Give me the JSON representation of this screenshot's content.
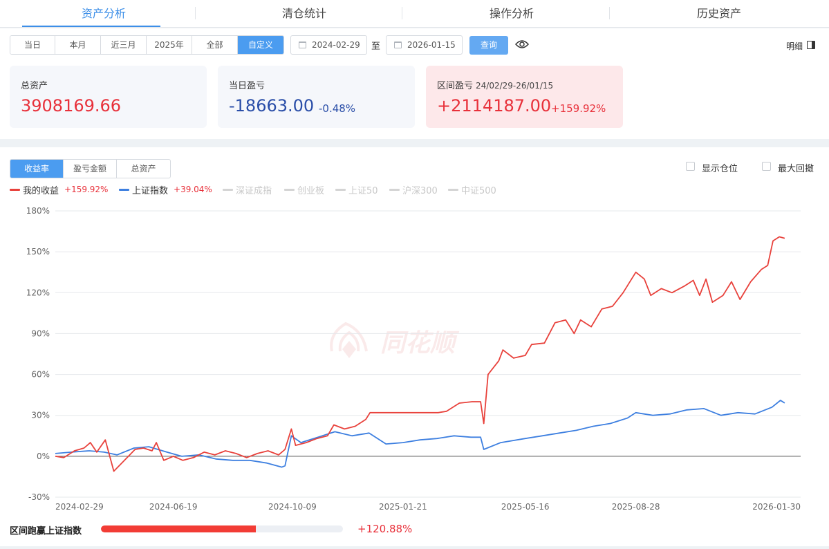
{
  "top_tabs": [
    {
      "label": "资产分析",
      "active": true
    },
    {
      "label": "清仓统计",
      "active": false
    },
    {
      "label": "操作分析",
      "active": false
    },
    {
      "label": "历史资产",
      "active": false
    }
  ],
  "toolbar": {
    "ranges": [
      {
        "label": "当日",
        "active": false
      },
      {
        "label": "本月",
        "active": false
      },
      {
        "label": "近三月",
        "active": false
      },
      {
        "label": "2025年",
        "active": false
      },
      {
        "label": "全部",
        "active": false
      },
      {
        "label": "自定义",
        "active": true
      }
    ],
    "start_date": "2024-02-29",
    "to_label": "至",
    "end_date": "2026-01-15",
    "query_label": "查询",
    "detail_label": "明细"
  },
  "cards": {
    "total_assets": {
      "label": "总资产",
      "value": "3908169.66"
    },
    "daily_pnl": {
      "label": "当日盈亏",
      "value": "-18663.00",
      "pct": "-0.48%"
    },
    "range_pnl": {
      "label": "区间盈亏",
      "range": "24/02/29-26/01/15",
      "value": "+2114187.00",
      "pct": "+159.92%"
    }
  },
  "chart_tabs": [
    {
      "label": "收益率",
      "active": true
    },
    {
      "label": "盈亏金额",
      "active": false
    },
    {
      "label": "总资产",
      "active": false
    }
  ],
  "options": {
    "show_position": "显示仓位",
    "max_drawdown": "最大回撤"
  },
  "legend": [
    {
      "name": "我的收益",
      "value": "+159.92%",
      "color": "#e8413b",
      "active": true
    },
    {
      "name": "上证指数",
      "value": "+39.04%",
      "color": "#3d7fe0",
      "active": true
    },
    {
      "name": "深证成指",
      "active": false
    },
    {
      "name": "创业板",
      "active": false
    },
    {
      "name": "上证50",
      "active": false
    },
    {
      "name": "沪深300",
      "active": false
    },
    {
      "name": "中证500",
      "active": false
    }
  ],
  "watermark": "同花顺",
  "chart_data": {
    "type": "line",
    "y_unit": "%",
    "ylim": [
      -30,
      180
    ],
    "yticks": [
      -30,
      0,
      30,
      60,
      90,
      120,
      150,
      180
    ],
    "ytick_labels": [
      "-30%",
      "0%",
      "30%",
      "60%",
      "90%",
      "120%",
      "150%",
      "180%"
    ],
    "xtick_labels": [
      "2024-02-29",
      "2024-06-19",
      "2024-10-09",
      "2025-01-21",
      "2025-05-16",
      "2025-08-28",
      "2026-01-30"
    ],
    "grid": true,
    "series": [
      {
        "name": "我的收益",
        "color": "#e8413b",
        "points": [
          [
            "2024-02-29",
            0
          ],
          [
            "2024-03-08",
            -1
          ],
          [
            "2024-03-18",
            4
          ],
          [
            "2024-03-27",
            6
          ],
          [
            "2024-04-02",
            10
          ],
          [
            "2024-04-08",
            3
          ],
          [
            "2024-04-16",
            12
          ],
          [
            "2024-04-24",
            -11
          ],
          [
            "2024-05-04",
            -3
          ],
          [
            "2024-05-14",
            5
          ],
          [
            "2024-05-22",
            6
          ],
          [
            "2024-05-30",
            4
          ],
          [
            "2024-06-03",
            10
          ],
          [
            "2024-06-10",
            -3
          ],
          [
            "2024-06-19",
            0
          ],
          [
            "2024-06-28",
            -3
          ],
          [
            "2024-07-08",
            -1
          ],
          [
            "2024-07-18",
            3
          ],
          [
            "2024-07-28",
            1
          ],
          [
            "2024-08-07",
            4
          ],
          [
            "2024-08-17",
            2
          ],
          [
            "2024-08-27",
            -1
          ],
          [
            "2024-09-06",
            2
          ],
          [
            "2024-09-16",
            4
          ],
          [
            "2024-09-26",
            1
          ],
          [
            "2024-10-02",
            5
          ],
          [
            "2024-10-08",
            20
          ],
          [
            "2024-10-12",
            8
          ],
          [
            "2024-10-22",
            10
          ],
          [
            "2024-11-01",
            13
          ],
          [
            "2024-11-11",
            15
          ],
          [
            "2024-11-17",
            23
          ],
          [
            "2024-11-27",
            20
          ],
          [
            "2024-12-07",
            22
          ],
          [
            "2024-12-17",
            27
          ],
          [
            "2024-12-21",
            32
          ],
          [
            "2025-01-21",
            32
          ],
          [
            "2025-02-23",
            32
          ],
          [
            "2025-03-03",
            33
          ],
          [
            "2025-03-15",
            39
          ],
          [
            "2025-03-27",
            40
          ],
          [
            "2025-04-04",
            40
          ],
          [
            "2025-04-07",
            24
          ],
          [
            "2025-04-11",
            60
          ],
          [
            "2025-04-21",
            70
          ],
          [
            "2025-04-25",
            78
          ],
          [
            "2025-05-05",
            72
          ],
          [
            "2025-05-16",
            74
          ],
          [
            "2025-05-22",
            82
          ],
          [
            "2025-06-03",
            83
          ],
          [
            "2025-06-13",
            98
          ],
          [
            "2025-06-23",
            100
          ],
          [
            "2025-07-01",
            90
          ],
          [
            "2025-07-07",
            100
          ],
          [
            "2025-07-17",
            95
          ],
          [
            "2025-07-27",
            108
          ],
          [
            "2025-08-06",
            110
          ],
          [
            "2025-08-16",
            120
          ],
          [
            "2025-08-28",
            135
          ],
          [
            "2025-09-05",
            130
          ],
          [
            "2025-09-11",
            118
          ],
          [
            "2025-09-21",
            123
          ],
          [
            "2025-10-01",
            120
          ],
          [
            "2025-10-13",
            125
          ],
          [
            "2025-10-21",
            129
          ],
          [
            "2025-10-27",
            118
          ],
          [
            "2025-11-02",
            130
          ],
          [
            "2025-11-08",
            113
          ],
          [
            "2025-11-18",
            118
          ],
          [
            "2025-11-26",
            128
          ],
          [
            "2025-12-04",
            115
          ],
          [
            "2025-12-14",
            128
          ],
          [
            "2025-12-24",
            137
          ],
          [
            "2025-12-30",
            140
          ],
          [
            "2026-01-04",
            158
          ],
          [
            "2026-01-10",
            161
          ],
          [
            "2026-01-15",
            159.92
          ]
        ]
      },
      {
        "name": "上证指数",
        "color": "#3d7fe0",
        "points": [
          [
            "2024-02-29",
            2
          ],
          [
            "2024-03-15",
            3
          ],
          [
            "2024-04-01",
            4
          ],
          [
            "2024-04-15",
            3
          ],
          [
            "2024-04-27",
            1
          ],
          [
            "2024-05-13",
            6
          ],
          [
            "2024-05-27",
            7
          ],
          [
            "2024-06-13",
            3
          ],
          [
            "2024-06-27",
            0
          ],
          [
            "2024-07-13",
            1
          ],
          [
            "2024-07-29",
            -2
          ],
          [
            "2024-08-14",
            -3
          ],
          [
            "2024-08-30",
            -3
          ],
          [
            "2024-09-15",
            -5
          ],
          [
            "2024-09-29",
            -8
          ],
          [
            "2024-10-02",
            -7
          ],
          [
            "2024-10-08",
            15
          ],
          [
            "2024-10-17",
            10
          ],
          [
            "2024-11-02",
            14
          ],
          [
            "2024-11-18",
            18
          ],
          [
            "2024-12-04",
            15
          ],
          [
            "2024-12-20",
            17
          ],
          [
            "2025-01-05",
            9
          ],
          [
            "2025-01-21",
            10
          ],
          [
            "2025-02-06",
            12
          ],
          [
            "2025-02-22",
            13
          ],
          [
            "2025-03-10",
            15
          ],
          [
            "2025-03-26",
            14
          ],
          [
            "2025-04-04",
            14
          ],
          [
            "2025-04-07",
            5
          ],
          [
            "2025-04-23",
            10
          ],
          [
            "2025-05-16",
            13
          ],
          [
            "2025-06-01",
            15
          ],
          [
            "2025-06-17",
            17
          ],
          [
            "2025-07-03",
            19
          ],
          [
            "2025-07-19",
            22
          ],
          [
            "2025-08-04",
            24
          ],
          [
            "2025-08-20",
            28
          ],
          [
            "2025-08-28",
            32
          ],
          [
            "2025-09-13",
            30
          ],
          [
            "2025-09-29",
            31
          ],
          [
            "2025-10-15",
            34
          ],
          [
            "2025-10-31",
            35
          ],
          [
            "2025-11-16",
            30
          ],
          [
            "2025-12-02",
            32
          ],
          [
            "2025-12-18",
            31
          ],
          [
            "2026-01-03",
            36
          ],
          [
            "2026-01-11",
            41
          ],
          [
            "2026-01-15",
            39.04
          ]
        ]
      }
    ]
  },
  "outperform": {
    "label": "区间跑赢上证指数",
    "value": "+120.88%",
    "fill_fraction": 0.64
  }
}
